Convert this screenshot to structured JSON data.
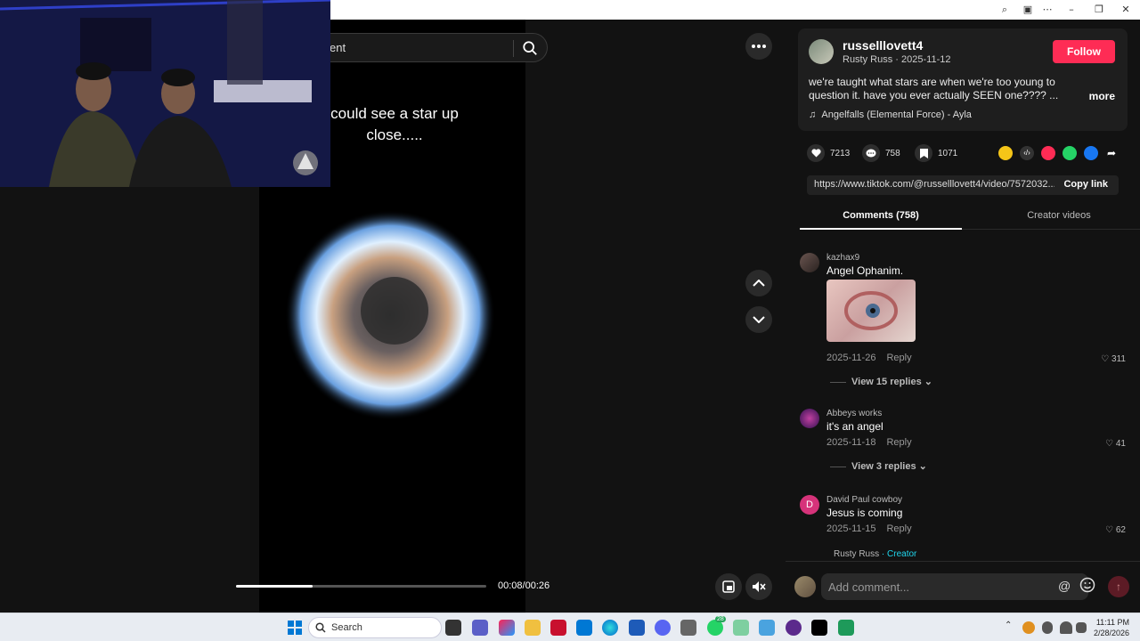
{
  "browser": {
    "controls": [
      "⌕",
      "▣",
      "⋯",
      "–",
      "❐",
      "✕"
    ]
  },
  "video": {
    "search_fragment": "ent",
    "caption_line1": "could see a star up",
    "caption_line2": "close.....",
    "progress_fraction": 0.3077,
    "time": "00:08/00:26"
  },
  "post": {
    "username": "russelllovett4",
    "subline": "Rusty Russ · 2025-11-12",
    "follow_label": "Follow",
    "description": "we're taught what stars are when we're too young to question it. have you ever actually SEEN one???? ...",
    "more_label": "more",
    "music_icon": "♫",
    "music": "Angelfalls (Elemental Force) - Ayla",
    "likes": "7213",
    "comments": "758",
    "saves": "1071",
    "url": "https://www.tiktok.com/@russelllovett4/video/7572032...",
    "copy_label": "Copy link"
  },
  "tabs": {
    "comments_label": "Comments (758)",
    "creator_label": "Creator videos"
  },
  "comments": [
    {
      "name": "kazhax9",
      "text": "Angel Ophanim.",
      "date": "2025-11-26",
      "reply": "Reply",
      "likes": "311",
      "replies": "View 15 replies"
    },
    {
      "name": "Abbeys works",
      "text": "it's an angel",
      "date": "2025-11-18",
      "reply": "Reply",
      "likes": "41",
      "replies": "View 3 replies"
    },
    {
      "name": "David Paul cowboy",
      "initial": "D",
      "text": "Jesus is coming",
      "date": "2025-11-15",
      "reply": "Reply",
      "likes": "62"
    },
    {
      "name": "Rusty Russ",
      "badge": "· Creator"
    }
  ],
  "add_comment": {
    "placeholder": "Add comment...",
    "at": "@"
  },
  "taskbar": {
    "search_label": "Search",
    "badge": "28",
    "time": "11:11 PM",
    "date": "2/28/2026"
  }
}
